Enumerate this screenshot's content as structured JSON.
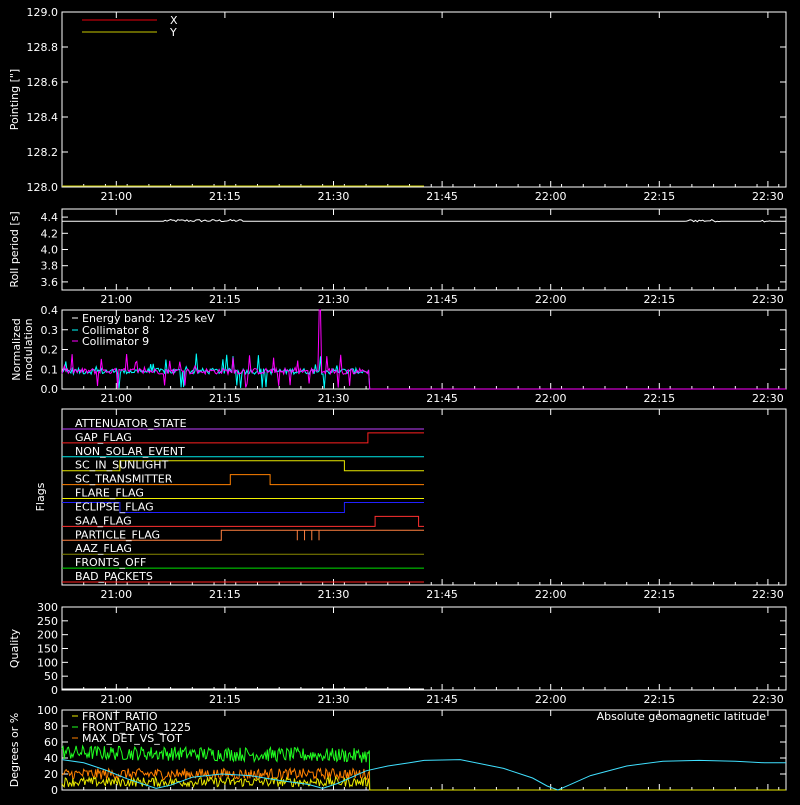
{
  "chart_data": [
    {
      "type": "line",
      "ylabel": "Pointing [\"]",
      "ylim": [
        128.0,
        129.0
      ],
      "yticks": [
        "128.0",
        "128.2",
        "128.4",
        "128.6",
        "128.8",
        "129.0"
      ],
      "legend": "top-left",
      "series": [
        {
          "name": "X",
          "color": "#e8000b",
          "points": [
            [
              0,
              128.0
            ],
            [
              100,
              128.0
            ]
          ]
        },
        {
          "name": "Y",
          "color": "#c8c800",
          "points": [
            [
              0,
              128.0
            ],
            [
              100,
              128.0
            ]
          ]
        }
      ]
    },
    {
      "type": "line",
      "ylabel": "Roll period [s]",
      "ylim": [
        3.5,
        4.5
      ],
      "yticks": [
        "3.6",
        "3.8",
        "4.0",
        "4.2",
        "4.4"
      ],
      "series": [
        {
          "color": "#ffffff",
          "points": [
            [
              0,
              4.35
            ],
            [
              100,
              4.35
            ]
          ]
        }
      ]
    },
    {
      "type": "line",
      "ylabel": "Normalized modulation",
      "ylim": [
        0,
        0.4
      ],
      "yticks": [
        "0.0",
        "0.1",
        "0.2",
        "0.3",
        "0.4"
      ],
      "annotation": "Energy band: 12-25 keV",
      "legend": "top-left",
      "series": [
        {
          "name": "Collimator 8",
          "color": "#00ffff",
          "baseline": 0.09,
          "end_minutes": 85
        },
        {
          "name": "Collimator 9",
          "color": "#ff00ff",
          "baseline": 0.09,
          "end_minutes": 85
        }
      ]
    },
    {
      "type": "line",
      "ylabel": "Flags",
      "series": [
        {
          "name": "ATTENUATOR_STATE",
          "color": "#c040ff",
          "steps": [
            [
              0,
              0
            ],
            [
              100,
              0
            ]
          ]
        },
        {
          "name": "GAP_FLAG",
          "color": "#ff2020",
          "steps": [
            [
              0,
              0
            ],
            [
              84.5,
              1
            ],
            [
              100,
              1
            ]
          ]
        },
        {
          "name": "NON_SOLAR_EVENT",
          "color": "#00e8e8",
          "steps": [
            [
              0,
              0
            ],
            [
              100,
              0
            ]
          ]
        },
        {
          "name": "SC_IN_SUNLIGHT",
          "color": "#e8e800",
          "steps": [
            [
              0,
              0
            ],
            [
              16,
              1
            ],
            [
              78,
              0
            ],
            [
              100,
              0
            ]
          ]
        },
        {
          "name": "SC_TRANSMITTER",
          "color": "#ff8000",
          "steps": [
            [
              0,
              0
            ],
            [
              46.5,
              1
            ],
            [
              57.5,
              0
            ],
            [
              100,
              0
            ]
          ]
        },
        {
          "name": "FLARE_FLAG",
          "color": "#f0f000",
          "steps": [
            [
              0,
              0
            ],
            [
              100,
              0
            ]
          ]
        },
        {
          "name": "ECLIPSE_FLAG",
          "color": "#2020ff",
          "steps": [
            [
              0,
              1
            ],
            [
              16,
              0
            ],
            [
              78,
              1
            ],
            [
              100,
              1
            ]
          ]
        },
        {
          "name": "SAA_FLAG",
          "color": "#ff3030",
          "steps": [
            [
              0,
              0
            ],
            [
              86.5,
              1
            ],
            [
              98.5,
              0
            ],
            [
              100,
              0
            ]
          ]
        },
        {
          "name": "PARTICLE_FLAG",
          "color": "#ff8040",
          "steps": [
            [
              0,
              0
            ],
            [
              44,
              1
            ],
            [
              86,
              1
            ],
            [
              100,
              1
            ]
          ]
        },
        {
          "name": "AAZ_FLAG",
          "color": "#888800",
          "steps": [
            [
              0,
              0
            ],
            [
              100,
              0
            ]
          ]
        },
        {
          "name": "FRONTS_OFF",
          "color": "#00e000",
          "steps": [
            [
              0,
              0
            ],
            [
              100,
              0
            ]
          ]
        },
        {
          "name": "BAD_PACKETS",
          "color": "#ff2020",
          "steps": [
            [
              0,
              0
            ],
            [
              100,
              0
            ]
          ]
        }
      ]
    },
    {
      "type": "line",
      "ylabel": "Quality",
      "ylim": [
        0,
        300
      ],
      "yticks": [
        "0",
        "50",
        "100",
        "150",
        "200",
        "250",
        "300"
      ],
      "series": [
        {
          "color": "#ffffff",
          "points": [
            [
              0,
              0
            ],
            [
              100,
              0
            ]
          ]
        }
      ]
    },
    {
      "type": "line",
      "ylabel": "Degrees or %",
      "ylim": [
        0,
        100
      ],
      "yticks": [
        "0",
        "20",
        "40",
        "60",
        "80",
        "100"
      ],
      "annotation": "Absolute geomagnetic latitude",
      "annotation_color": "#40e0ff",
      "legend": "top-left",
      "series": [
        {
          "name": "FRONT_RATIO",
          "color": "#e8e800",
          "baseline": 10,
          "noise": 6,
          "end_minutes": 85
        },
        {
          "name": "FRONT_RATIO_1225",
          "color": "#20ff20",
          "baseline": 47,
          "noise": 9,
          "end_minutes": 85
        },
        {
          "name": "MAX_DET_VS_TOT",
          "color": "#ff8000",
          "baseline": 20,
          "noise": 7,
          "end_minutes": 85
        },
        {
          "name": "Absolute geomagnetic latitude",
          "color": "#40e0ff",
          "points": [
            [
              0,
              38
            ],
            [
              6,
              34
            ],
            [
              12,
              25
            ],
            [
              18,
              14
            ],
            [
              22,
              8
            ],
            [
              26,
              2
            ],
            [
              30,
              6
            ],
            [
              36,
              16
            ],
            [
              44,
              20
            ],
            [
              52,
              18
            ],
            [
              60,
              12
            ],
            [
              68,
              7
            ],
            [
              72,
              2
            ],
            [
              76,
              8
            ],
            [
              84,
              24
            ],
            [
              90,
              30
            ],
            [
              96,
              34
            ],
            [
              100,
              37
            ],
            [
              110,
              38
            ],
            [
              122,
              27
            ],
            [
              130,
              15
            ],
            [
              134,
              5
            ],
            [
              137,
              0
            ],
            [
              140,
              6
            ],
            [
              146,
              18
            ],
            [
              156,
              30
            ],
            [
              166,
              36
            ],
            [
              176,
              37
            ],
            [
              186,
              36
            ],
            [
              194,
              34
            ],
            [
              200,
              34
            ]
          ]
        }
      ]
    }
  ],
  "time_axis": {
    "xlim_minutes": [
      0,
      200
    ],
    "tick_minutes": [
      15,
      45,
      75,
      105,
      135,
      165,
      195
    ],
    "tick_labels": [
      "21:00",
      "21:15",
      "21:30",
      "21:45",
      "22:00",
      "22:15",
      "22:30"
    ]
  }
}
